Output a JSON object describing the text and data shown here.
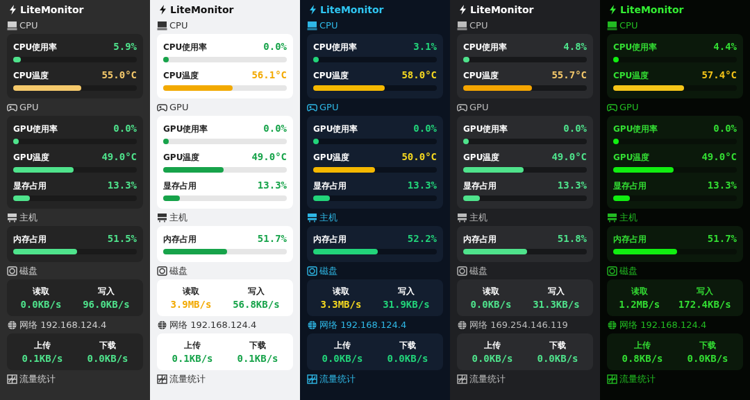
{
  "panels": [
    {
      "kind": "dark",
      "title": "LiteMonitor",
      "sections": [
        {
          "kind": "cpu",
          "heading": "CPU",
          "metrics": [
            {
              "label": "CPU使用率",
              "value": "5.9%",
              "level": 0.059,
              "warning": false
            },
            {
              "label": "CPU温度",
              "value": "55.0°C",
              "level": 0.55,
              "warning": true
            }
          ]
        },
        {
          "kind": "gpu",
          "heading": "GPU",
          "metrics": [
            {
              "label": "GPU使用率",
              "value": "0.0%",
              "level": 0,
              "warning": false
            },
            {
              "label": "GPU温度",
              "value": "49.0°C",
              "level": 0.49,
              "warning": false
            },
            {
              "label": "显存占用",
              "value": "13.3%",
              "level": 0.133,
              "warning": false
            }
          ]
        },
        {
          "kind": "host",
          "heading": "主机",
          "metrics": [
            {
              "label": "内存占用",
              "value": "51.5%",
              "level": 0.515,
              "warning": false
            }
          ]
        },
        {
          "kind": "disk",
          "heading": "磁盘",
          "pairs": [
            {
              "label": "读取",
              "value": "0.0KB/s",
              "warning": false
            },
            {
              "label": "写入",
              "value": "96.0KB/s",
              "warning": false
            }
          ]
        },
        {
          "kind": "network",
          "heading": "网络 192.168.124.4",
          "pairs": [
            {
              "label": "上传",
              "value": "0.1KB/s",
              "warning": false
            },
            {
              "label": "下载",
              "value": "0.0KB/s",
              "warning": false
            }
          ]
        },
        {
          "kind": "traffic",
          "heading": "流量统计"
        }
      ]
    },
    {
      "kind": "light",
      "title": "LiteMonitor",
      "sections": [
        {
          "kind": "cpu",
          "heading": "CPU",
          "metrics": [
            {
              "label": "CPU使用率",
              "value": "0.0%",
              "level": 0,
              "warning": false
            },
            {
              "label": "CPU温度",
              "value": "56.1°C",
              "level": 0.561,
              "warning": true
            }
          ]
        },
        {
          "kind": "gpu",
          "heading": "GPU",
          "metrics": [
            {
              "label": "GPU使用率",
              "value": "0.0%",
              "level": 0,
              "warning": false
            },
            {
              "label": "GPU温度",
              "value": "49.0°C",
              "level": 0.49,
              "warning": false
            },
            {
              "label": "显存占用",
              "value": "13.3%",
              "level": 0.133,
              "warning": false
            }
          ]
        },
        {
          "kind": "host",
          "heading": "主机",
          "metrics": [
            {
              "label": "内存占用",
              "value": "51.7%",
              "level": 0.517,
              "warning": false
            }
          ]
        },
        {
          "kind": "disk",
          "heading": "磁盘",
          "pairs": [
            {
              "label": "读取",
              "value": "3.9MB/s",
              "warning": true
            },
            {
              "label": "写入",
              "value": "56.8KB/s",
              "warning": false
            }
          ]
        },
        {
          "kind": "network",
          "heading": "网络 192.168.124.4",
          "pairs": [
            {
              "label": "上传",
              "value": "0.1KB/s",
              "warning": false
            },
            {
              "label": "下载",
              "value": "0.1KB/s",
              "warning": false
            }
          ]
        },
        {
          "kind": "traffic",
          "heading": "流量统计"
        }
      ]
    },
    {
      "kind": "navy",
      "title": "LiteMonitor",
      "sections": [
        {
          "kind": "cpu",
          "heading": "CPU",
          "metrics": [
            {
              "label": "CPU使用率",
              "value": "3.1%",
              "level": 0.031,
              "warning": false
            },
            {
              "label": "CPU温度",
              "value": "58.0°C",
              "level": 0.58,
              "warning": true
            }
          ]
        },
        {
          "kind": "gpu",
          "heading": "GPU",
          "metrics": [
            {
              "label": "GPU使用率",
              "value": "0.0%",
              "level": 0,
              "warning": false
            },
            {
              "label": "GPU温度",
              "value": "50.0°C",
              "level": 0.5,
              "warning": true
            },
            {
              "label": "显存占用",
              "value": "13.3%",
              "level": 0.133,
              "warning": false
            }
          ]
        },
        {
          "kind": "host",
          "heading": "主机",
          "metrics": [
            {
              "label": "内存占用",
              "value": "52.2%",
              "level": 0.522,
              "warning": false
            }
          ]
        },
        {
          "kind": "disk",
          "heading": "磁盘",
          "pairs": [
            {
              "label": "读取",
              "value": "3.3MB/s",
              "warning": true
            },
            {
              "label": "写入",
              "value": "31.9KB/s",
              "warning": false
            }
          ]
        },
        {
          "kind": "network",
          "heading": "网络 192.168.124.4",
          "pairs": [
            {
              "label": "上传",
              "value": "0.0KB/s",
              "warning": false
            },
            {
              "label": "下载",
              "value": "0.0KB/s",
              "warning": false
            }
          ]
        },
        {
          "kind": "traffic",
          "heading": "流量统计"
        }
      ]
    },
    {
      "kind": "charcoal",
      "title": "LiteMonitor",
      "sections": [
        {
          "kind": "cpu",
          "heading": "CPU",
          "metrics": [
            {
              "label": "CPU使用率",
              "value": "4.8%",
              "level": 0.048,
              "warning": false
            },
            {
              "label": "CPU温度",
              "value": "55.7°C",
              "level": 0.557,
              "warning": true
            }
          ]
        },
        {
          "kind": "gpu",
          "heading": "GPU",
          "metrics": [
            {
              "label": "GPU使用率",
              "value": "0.0%",
              "level": 0,
              "warning": false
            },
            {
              "label": "GPU温度",
              "value": "49.0°C",
              "level": 0.49,
              "warning": false
            },
            {
              "label": "显存占用",
              "value": "13.3%",
              "level": 0.133,
              "warning": false
            }
          ]
        },
        {
          "kind": "host",
          "heading": "主机",
          "metrics": [
            {
              "label": "内存占用",
              "value": "51.8%",
              "level": 0.518,
              "warning": false
            }
          ]
        },
        {
          "kind": "disk",
          "heading": "磁盘",
          "pairs": [
            {
              "label": "读取",
              "value": "0.0KB/s",
              "warning": false
            },
            {
              "label": "写入",
              "value": "31.3KB/s",
              "warning": false
            }
          ]
        },
        {
          "kind": "network",
          "heading": "网络 169.254.146.119",
          "pairs": [
            {
              "label": "上传",
              "value": "0.0KB/s",
              "warning": false
            },
            {
              "label": "下载",
              "value": "0.0KB/s",
              "warning": false
            }
          ]
        },
        {
          "kind": "traffic",
          "heading": "流量统计"
        }
      ]
    },
    {
      "kind": "matrix",
      "title": "LiteMonitor",
      "sections": [
        {
          "kind": "cpu",
          "heading": "CPU",
          "metrics": [
            {
              "label": "CPU使用率",
              "value": "4.4%",
              "level": 0.044,
              "warning": false
            },
            {
              "label": "CPU温度",
              "value": "57.4°C",
              "level": 0.574,
              "warning": true
            }
          ]
        },
        {
          "kind": "gpu",
          "heading": "GPU",
          "metrics": [
            {
              "label": "GPU使用率",
              "value": "0.0%",
              "level": 0,
              "warning": false
            },
            {
              "label": "GPU温度",
              "value": "49.0°C",
              "level": 0.49,
              "warning": false
            },
            {
              "label": "显存占用",
              "value": "13.3%",
              "level": 0.133,
              "warning": false
            }
          ]
        },
        {
          "kind": "host",
          "heading": "主机",
          "metrics": [
            {
              "label": "内存占用",
              "value": "51.7%",
              "level": 0.517,
              "warning": false
            }
          ]
        },
        {
          "kind": "disk",
          "heading": "磁盘",
          "pairs": [
            {
              "label": "读取",
              "value": "1.2MB/s",
              "warning": false
            },
            {
              "label": "写入",
              "value": "172.4KB/s",
              "warning": false
            }
          ]
        },
        {
          "kind": "network",
          "heading": "网络 192.168.124.4",
          "pairs": [
            {
              "label": "上传",
              "value": "0.8KB/s",
              "warning": false
            },
            {
              "label": "下载",
              "value": "0.0KB/s",
              "warning": false
            }
          ]
        },
        {
          "kind": "traffic",
          "heading": "流量统计"
        }
      ]
    }
  ]
}
